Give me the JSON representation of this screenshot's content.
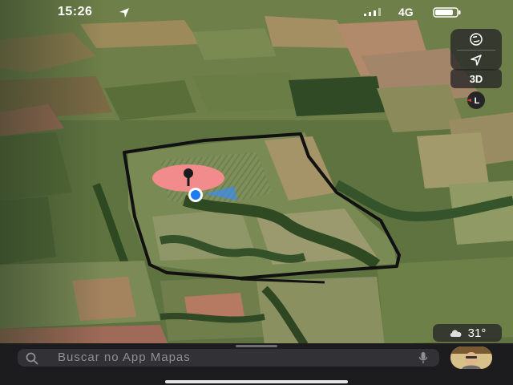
{
  "status_bar": {
    "time": "15:26",
    "network": "4G"
  },
  "map_controls": {
    "view_3d_label": "3D",
    "compass_letter": "L"
  },
  "weather": {
    "temperature": "31°"
  },
  "search": {
    "placeholder": "Buscar no App Mapas"
  },
  "icons": [
    "location-arrow-icon",
    "signal-icon",
    "battery-icon",
    "globe-icon",
    "navigate-icon",
    "compass-icon",
    "cloud-icon",
    "search-icon",
    "microphone-icon",
    "pin-icon"
  ],
  "colors": {
    "pin": "#f28b8b",
    "user_location": "#1e7cf2",
    "boundary": "#111111",
    "panel": "#1c1c1e"
  }
}
